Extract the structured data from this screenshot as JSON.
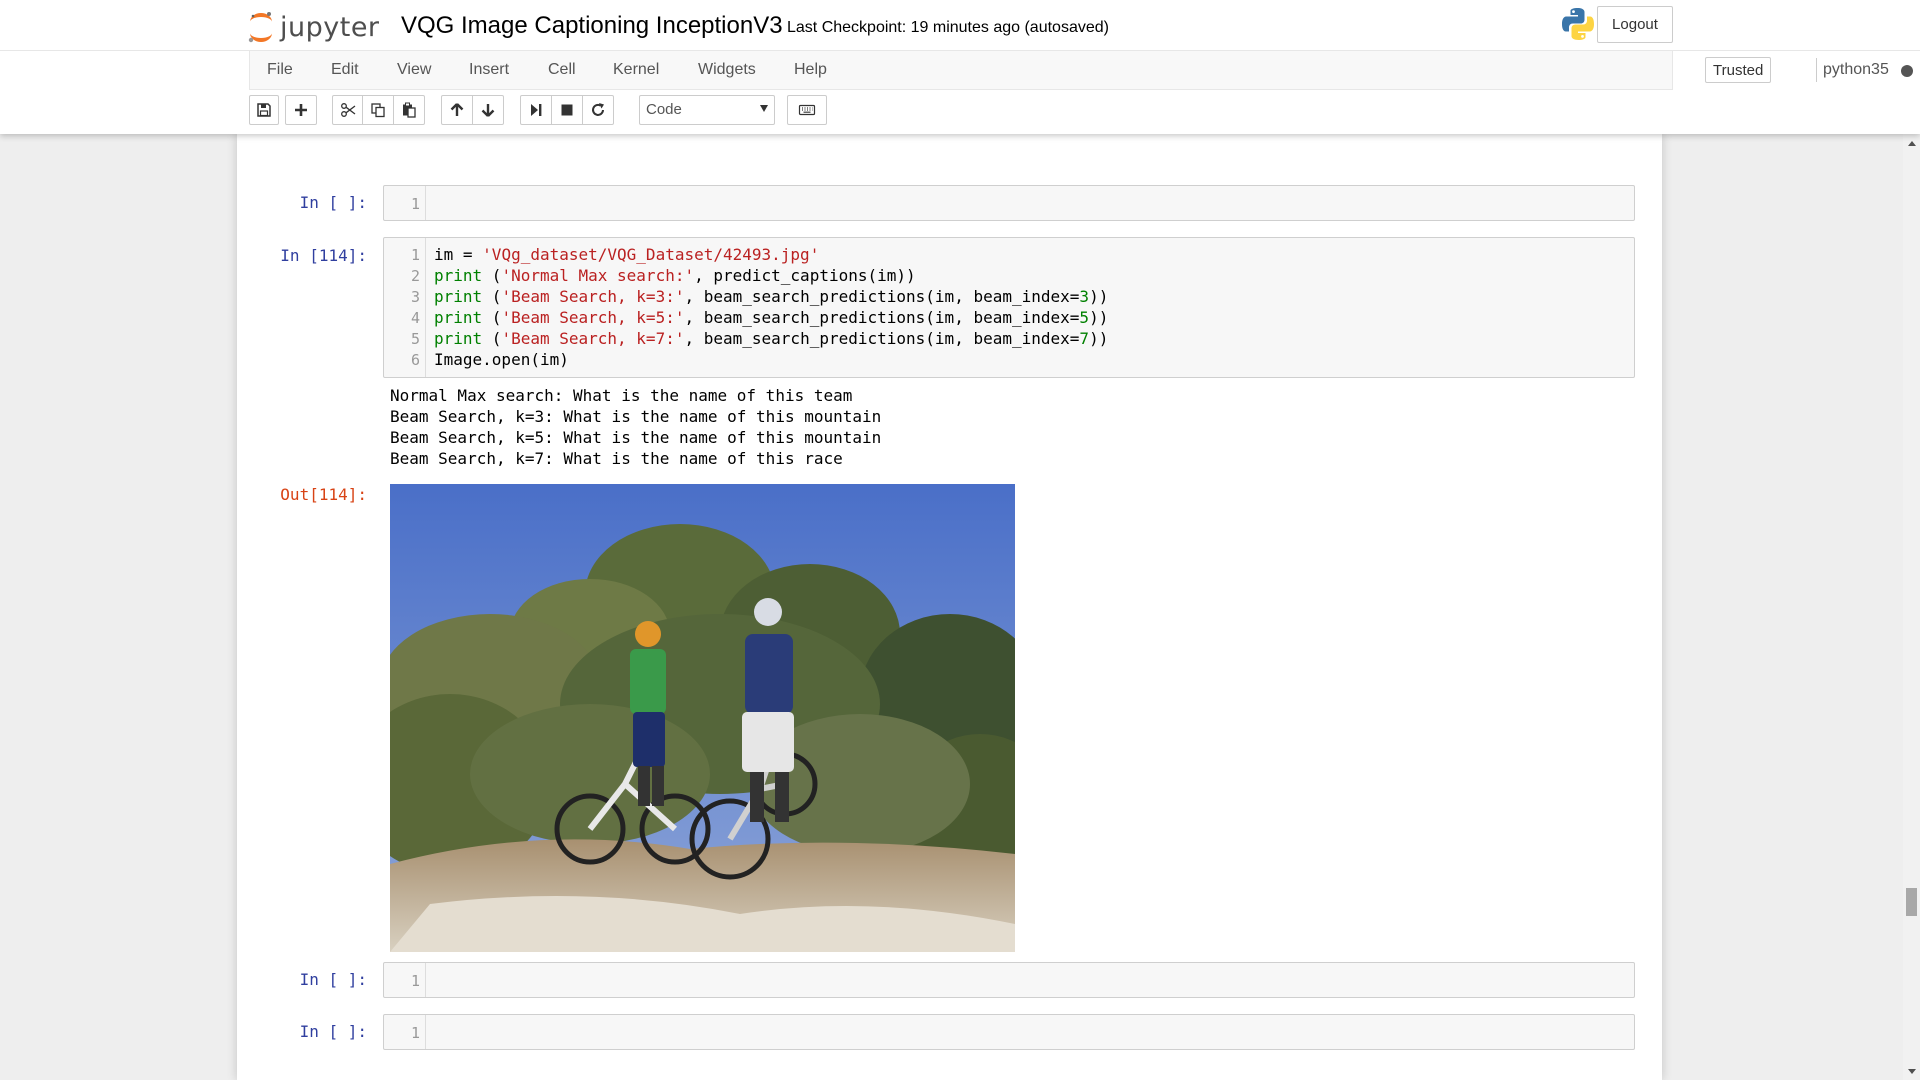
{
  "header": {
    "logo_text": "jupyter",
    "notebook_title": "VQG Image Captioning InceptionV3",
    "checkpoint": "Last Checkpoint: 19 minutes ago (autosaved)",
    "logout_label": "Logout"
  },
  "menu": {
    "items": [
      "File",
      "Edit",
      "View",
      "Insert",
      "Cell",
      "Kernel",
      "Widgets",
      "Help"
    ],
    "trusted_label": "Trusted",
    "kernel_name": "python35"
  },
  "toolbar": {
    "buttons": [
      "save-icon",
      "plus-icon",
      "cut-icon",
      "copy-icon",
      "paste-icon",
      "arrow-up-icon",
      "arrow-down-icon",
      "step-forward-icon",
      "stop-icon",
      "restart-icon"
    ],
    "cell_type": "Code",
    "keyboard_icon": "keyboard-icon"
  },
  "cells": [
    {
      "prompt": "In [ ]:",
      "lines": [
        "1"
      ]
    },
    {
      "prompt": "In [114]:",
      "line_numbers": [
        "1",
        "2",
        "3",
        "4",
        "5",
        "6"
      ],
      "code": {
        "l1_a": "im = ",
        "l1_b": "'VQg_dataset/VQG_Dataset/42493.jpg'",
        "l2_kw": "print",
        "l2_a": " (",
        "l2_str": "'Normal Max search:'",
        "l2_b": ", predict_captions(im))",
        "l3_kw": "print",
        "l3_a": " (",
        "l3_str": "'Beam Search, k=3:'",
        "l3_b": ", beam_search_predictions(im, beam_index=",
        "l3_num": "3",
        "l3_c": "))",
        "l4_kw": "print",
        "l4_a": " (",
        "l4_str": "'Beam Search, k=5:'",
        "l4_b": ", beam_search_predictions(im, beam_index=",
        "l4_num": "5",
        "l4_c": "))",
        "l5_kw": "print",
        "l5_a": " (",
        "l5_str": "'Beam Search, k=7:'",
        "l5_b": ", beam_search_predictions(im, beam_index=",
        "l5_num": "7",
        "l5_c": "))",
        "l6": "Image.open(im)"
      },
      "stdout": [
        "Normal Max search: What is the name of this team",
        "Beam Search, k=3: What is the name of this mountain",
        "Beam Search, k=5: What is the name of this mountain",
        "Beam Search, k=7: What is the name of this race"
      ],
      "out_prompt": "Out[114]:"
    },
    {
      "prompt": "In [ ]:",
      "lines": [
        "1"
      ]
    },
    {
      "prompt": "In [ ]:",
      "lines": [
        "1"
      ]
    }
  ],
  "colors": {
    "in_prompt": "#303f9f",
    "out_prompt": "#d84315",
    "keyword": "#008000",
    "string": "#ba2121",
    "jupyter_orange": "#f37726"
  }
}
